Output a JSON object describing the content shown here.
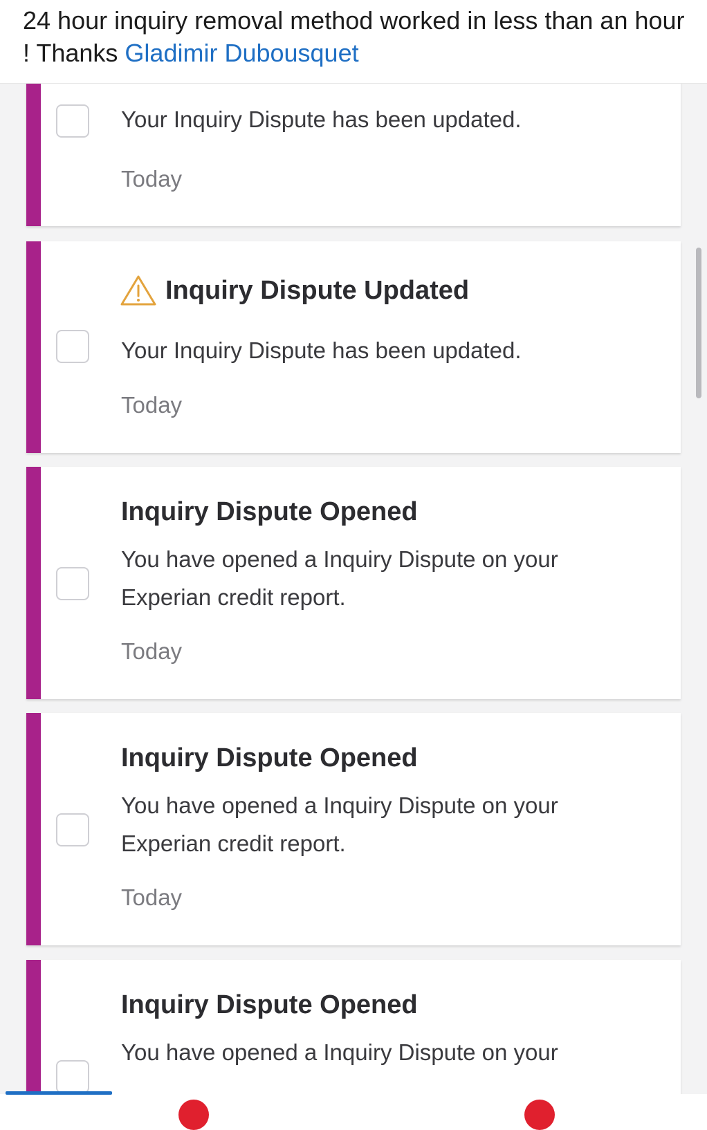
{
  "post": {
    "caption_text": "24 hour inquiry removal method worked in less than an hour ! Thanks ",
    "mention": "Gladimir Dubousquet"
  },
  "colors": {
    "accent_stripe": "#a8228a",
    "mention_link": "#1f6fc4",
    "warning_icon": "#e3a33d"
  },
  "notifications": [
    {
      "title": "",
      "icon": "",
      "message": "Your Inquiry Dispute has been updated.",
      "time": "Today"
    },
    {
      "title": "Inquiry Dispute Updated",
      "icon": "warning-triangle-icon",
      "message": "Your Inquiry Dispute has been updated.",
      "time": "Today"
    },
    {
      "title": "Inquiry Dispute Opened",
      "icon": "",
      "message": "You have opened a Inquiry Dispute on your Experian credit report.",
      "time": "Today"
    },
    {
      "title": "Inquiry Dispute Opened",
      "icon": "",
      "message": "You have opened a Inquiry Dispute on your Experian credit report.",
      "time": "Today"
    },
    {
      "title": "Inquiry Dispute Opened",
      "icon": "",
      "message": "You have opened a Inquiry Dispute on your",
      "time": ""
    }
  ]
}
